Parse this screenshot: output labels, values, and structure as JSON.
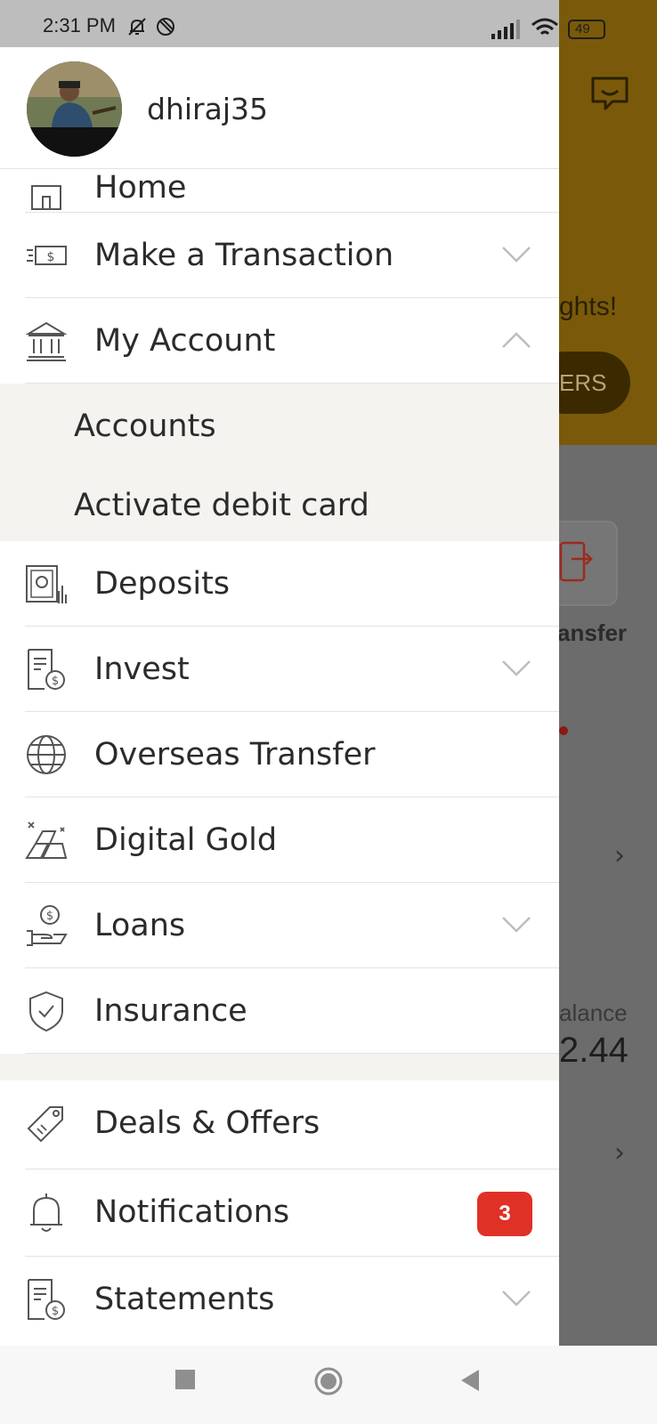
{
  "status_bar": {
    "time": "2:31 PM",
    "battery": "49",
    "icons": [
      "mute-icon",
      "dnd-icon",
      "signal-icon",
      "wifi-icon",
      "battery-icon"
    ]
  },
  "profile": {
    "username": "dhiraj35"
  },
  "menu": {
    "home": "Home",
    "make_transaction": "Make a Transaction",
    "my_account": "My Account",
    "accounts": "Accounts",
    "activate_debit_card": "Activate debit card",
    "deposits": "Deposits",
    "invest": "Invest",
    "overseas_transfer": "Overseas Transfer",
    "digital_gold": "Digital Gold",
    "loans": "Loans",
    "insurance": "Insurance",
    "deals_offers": "Deals & Offers",
    "notifications": "Notifications",
    "notifications_count": "3",
    "statements": "Statements"
  },
  "background": {
    "hero_text": "ghts!",
    "hero_button": "ERS",
    "transfer_label": "ansfer",
    "balance_label": "alance",
    "balance_value": "2.44"
  },
  "colors": {
    "accent_red": "#e03127",
    "drawer_bg": "#ffffff",
    "submenu_bg": "#f4f3f0",
    "hero_bg": "#7a5a0a"
  }
}
